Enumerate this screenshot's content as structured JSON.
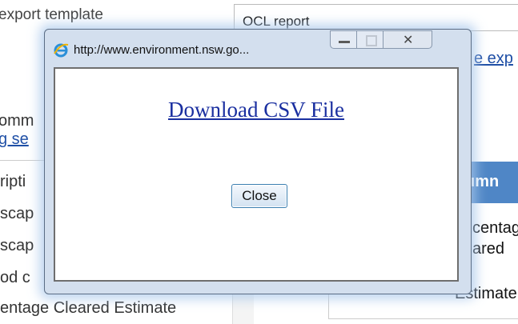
{
  "background": {
    "export_template_label": "export template",
    "report_input_value": "OCL report",
    "right_link_fragment": "e exp",
    "left_fragment_1": "omm",
    "left_fragment_2": "g se",
    "list_items": [
      "ripti",
      "scap",
      "scap",
      "od c",
      "entage Cleared Estimate"
    ],
    "column_header": "umn",
    "column_cell_lines": [
      "centag",
      "ared",
      "stimate"
    ],
    "column_cell_extra": "E"
  },
  "popup": {
    "url_title": "http://www.environment.nsw.go...",
    "download_link": "Download CSV File",
    "close_button": "Close"
  },
  "colors": {
    "link_blue": "#1a2fa0",
    "header_blue": "#4f86c6",
    "window_frame": "#d3dfee"
  },
  "icons": {
    "browser": "ie-icon",
    "minimize": "minimize-icon",
    "maximize": "maximize-icon",
    "close": "close-icon"
  }
}
